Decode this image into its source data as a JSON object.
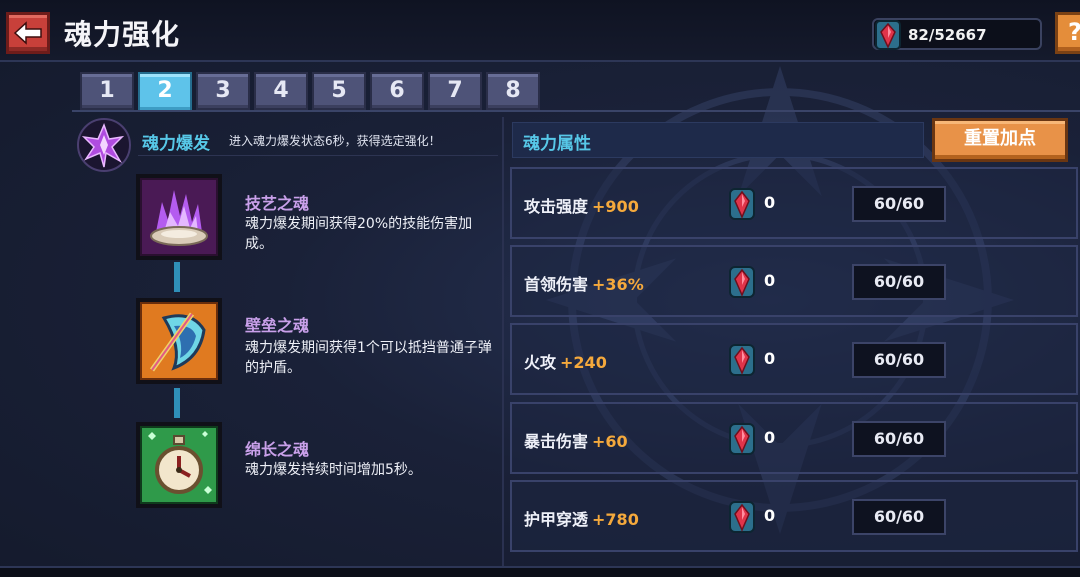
{
  "header": {
    "title": "魂力强化",
    "currency_value": "82/52667",
    "help_label": "?"
  },
  "tabs": [
    "1",
    "2",
    "3",
    "4",
    "5",
    "6",
    "7",
    "8"
  ],
  "active_tab": "2",
  "burst": {
    "title": "魂力爆发",
    "description": "进入魂力爆发状态6秒，获得选定强化！"
  },
  "skills": [
    {
      "name": "技艺之魂",
      "description": "魂力爆发期间获得20%的技能伤害加成。",
      "icon": "purple-flame-icon"
    },
    {
      "name": "壁垒之魂",
      "description": "魂力爆发期间获得1个可以抵挡普通子弹的护盾。",
      "icon": "shield-icon"
    },
    {
      "name": "绵长之魂",
      "description": "魂力爆发持续时间增加5秒。",
      "icon": "stopwatch-icon"
    }
  ],
  "attributes": {
    "header": "魂力属性",
    "reset_label": "重置加点",
    "rows": [
      {
        "name": "攻击强度",
        "bonus": "+900",
        "cost": "0",
        "level": "60/60"
      },
      {
        "name": "首领伤害",
        "bonus": "+36%",
        "cost": "0",
        "level": "60/60"
      },
      {
        "name": "火攻",
        "bonus": "+240",
        "cost": "0",
        "level": "60/60"
      },
      {
        "name": "暴击伤害",
        "bonus": "+60",
        "cost": "0",
        "level": "60/60"
      },
      {
        "name": "护甲穿透",
        "bonus": "+780",
        "cost": "0",
        "level": "60/60"
      }
    ]
  },
  "colors": {
    "accent_cyan": "#57c8e8",
    "bonus_orange": "#f5a93c",
    "skill_name_purple": "#c9a0ea",
    "back_button_red": "#c8403a",
    "reset_button_orange": "#e89248"
  }
}
